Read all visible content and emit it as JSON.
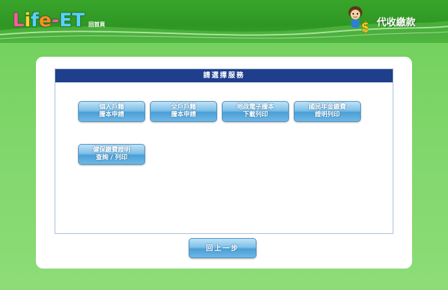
{
  "header": {
    "logo_parts": [
      "L",
      "i",
      "f",
      "e",
      "-",
      "E",
      "T"
    ],
    "home_label": "回首頁",
    "title": "代收繳款",
    "mascot_icon": "boy-with-dollar-icon"
  },
  "box": {
    "title": "請選擇服務"
  },
  "services": [
    {
      "line1": "個人戶籍",
      "line2": "謄本申請"
    },
    {
      "line1": "全戶戶籍",
      "line2": "謄本申請"
    },
    {
      "line1": "地政電子謄本",
      "line2": "下載列印"
    },
    {
      "line1": "國民年金繳費",
      "line2": "證明列印"
    },
    {
      "line1": "健保繳費證明",
      "line2": "查詢 / 列印"
    }
  ],
  "back_label": "回上一步",
  "colors": {
    "header_green": "#2f9624",
    "background_green": "#7fd66a",
    "box_header_navy": "#1f3f8c",
    "button_blue": "#4a9fd6"
  }
}
